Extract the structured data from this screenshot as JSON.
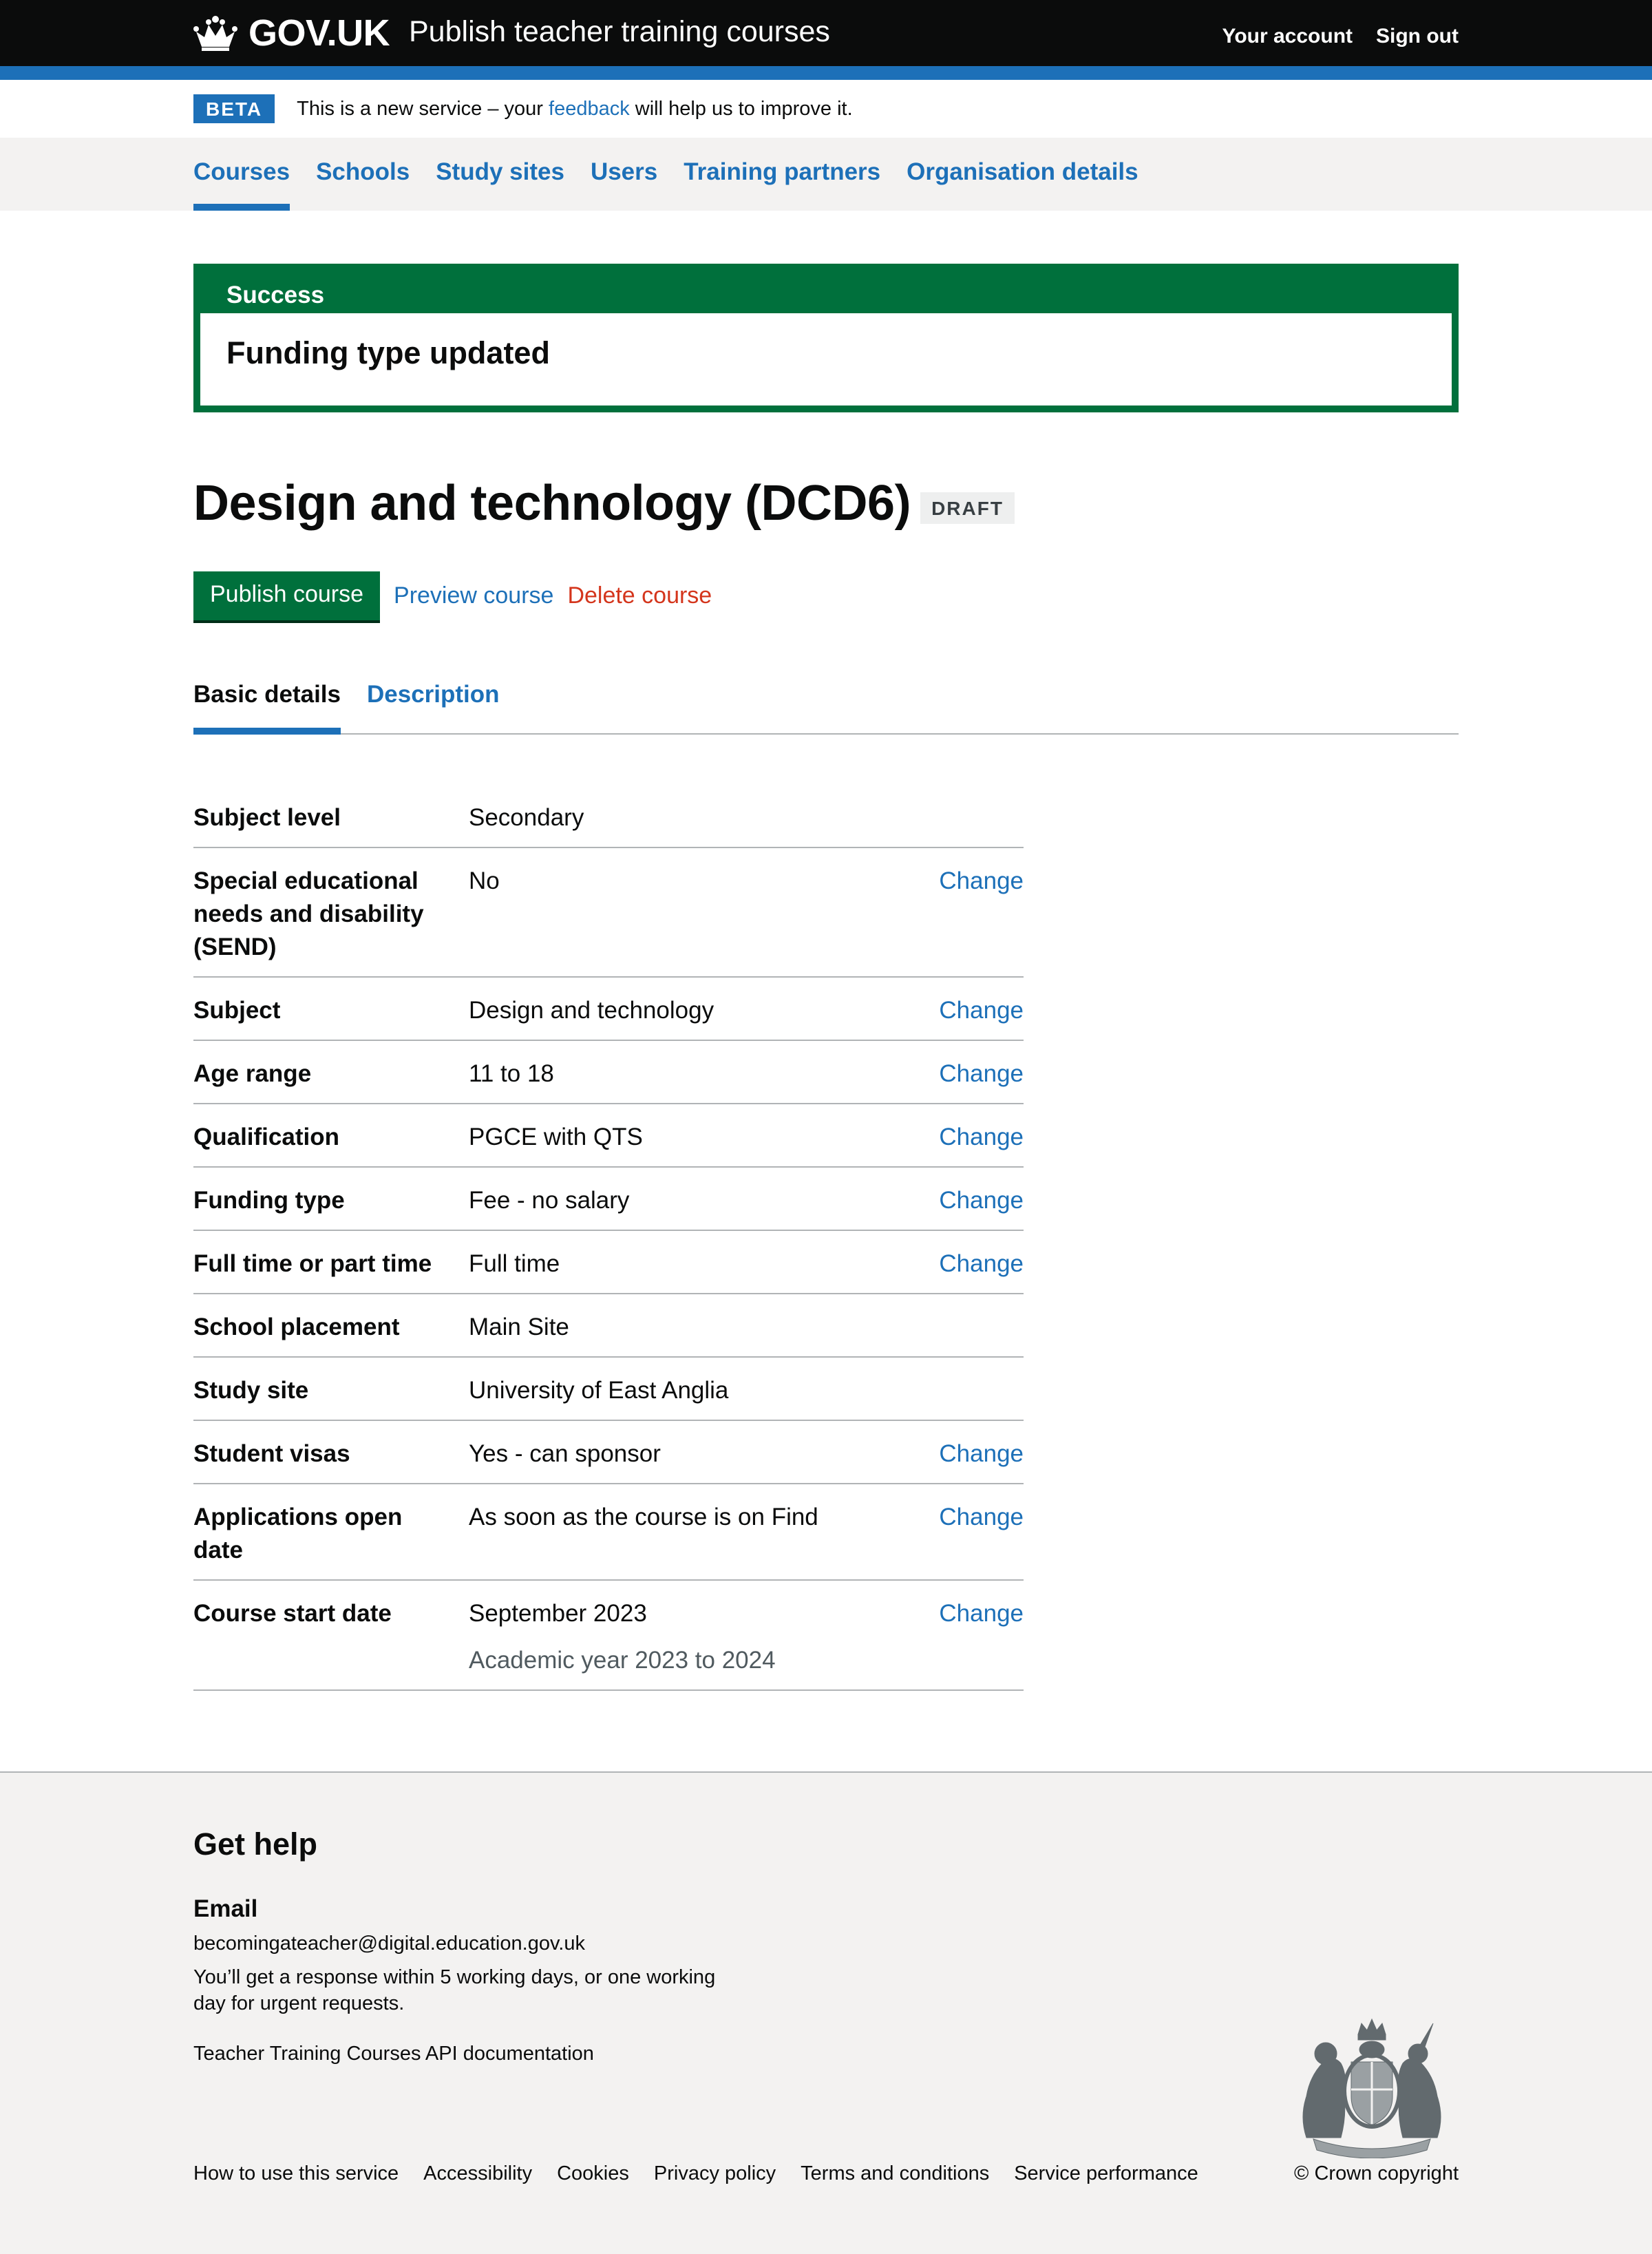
{
  "header": {
    "logo_text": "GOV.UK",
    "service_name": "Publish teacher training courses",
    "nav": [
      "Your account",
      "Sign out"
    ]
  },
  "phase_banner": {
    "tag": "BETA",
    "text_before": "This is a new service – your ",
    "link": "feedback",
    "text_after": " will help us to improve it."
  },
  "primary_nav": {
    "items": [
      "Courses",
      "Schools",
      "Study sites",
      "Users",
      "Training partners",
      "Organisation details"
    ],
    "active": "Courses"
  },
  "success": {
    "title": "Success",
    "message": "Funding type updated"
  },
  "course": {
    "title": "Design and technology (DCD6)",
    "status": "DRAFT"
  },
  "actions": {
    "publish": "Publish course",
    "preview": "Preview course",
    "delete": "Delete course"
  },
  "tabs": {
    "items": [
      "Basic details",
      "Description"
    ],
    "selected": "Basic details"
  },
  "summary": {
    "change_label": "Change",
    "rows": [
      {
        "key": "Subject level",
        "value": "Secondary",
        "secondary": "",
        "change": false
      },
      {
        "key": "Special educational needs and disability (SEND)",
        "value": "No",
        "secondary": "",
        "change": true
      },
      {
        "key": "Subject",
        "value": "Design and technology",
        "secondary": "",
        "change": true
      },
      {
        "key": "Age range",
        "value": "11 to 18",
        "secondary": "",
        "change": true
      },
      {
        "key": "Qualification",
        "value": "PGCE with QTS",
        "secondary": "",
        "change": true
      },
      {
        "key": "Funding type",
        "value": "Fee - no salary",
        "secondary": "",
        "change": true
      },
      {
        "key": "Full time or part time",
        "value": "Full time",
        "secondary": "",
        "change": true
      },
      {
        "key": "School placement",
        "value": "Main Site",
        "secondary": "",
        "change": false
      },
      {
        "key": "Study site",
        "value": "University of East Anglia",
        "secondary": "",
        "change": false
      },
      {
        "key": "Student visas",
        "value": "Yes - can sponsor",
        "secondary": "",
        "change": true
      },
      {
        "key": "Applications open date",
        "value": "As soon as the course is on Find",
        "secondary": "",
        "change": true
      },
      {
        "key": "Course start date",
        "value": "September 2023",
        "secondary": "Academic year 2023 to 2024",
        "change": true
      }
    ]
  },
  "footer": {
    "get_help": "Get help",
    "email_heading": "Email",
    "email": "becomingateacher@digital.education.gov.uk",
    "email_note": "You’ll get a response within 5 working days, or one working day for urgent requests.",
    "api_link": "Teacher Training Courses API documentation",
    "links": [
      "How to use this service",
      "Accessibility",
      "Cookies",
      "Privacy policy",
      "Terms and conditions",
      "Service performance"
    ],
    "copyright": "© Crown copyright"
  },
  "colors": {
    "header_bg": "#0b0c0c",
    "brand_blue": "#1d70b8",
    "success_green": "#00703c",
    "warning_red": "#d4351c",
    "footer_bg": "#f3f2f1"
  },
  "icons": {
    "logo": "crown-icon",
    "footer": "royal-coat-of-arms-icon"
  }
}
